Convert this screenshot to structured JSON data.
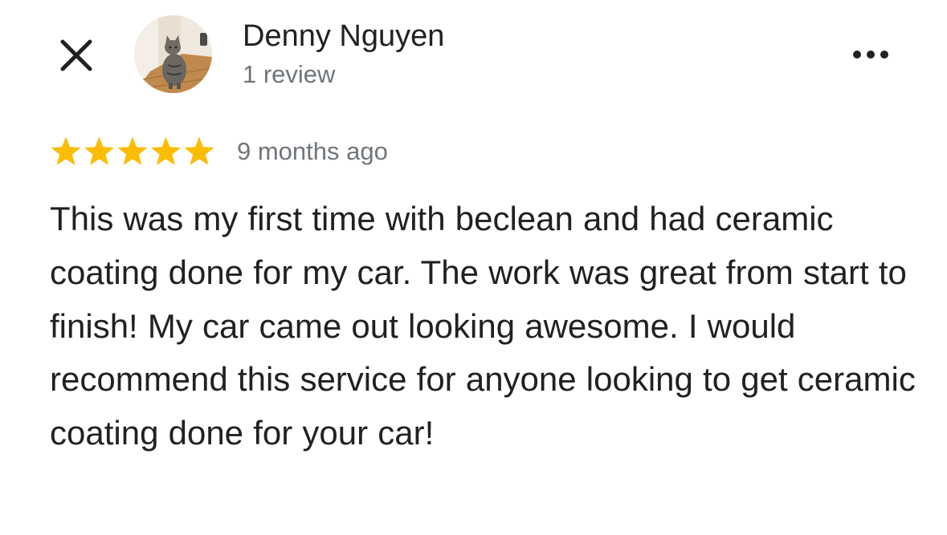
{
  "header": {
    "close_icon": "close-icon",
    "avatar_icon": "cat-photo-avatar",
    "reviewer_name": "Denny Nguyen",
    "review_count": "1 review",
    "more_icon": "more-horizontal-icon"
  },
  "review": {
    "rating": 5,
    "rating_max": 5,
    "star_color": "#fbbc04",
    "date": "9 months ago",
    "text": "This was my first time with beclean and had ceramic coating done for my car. The work was great from start to finish! My car came out looking awesome. I would recommend this service for anyone looking to get ceramic coating done for your car!"
  }
}
